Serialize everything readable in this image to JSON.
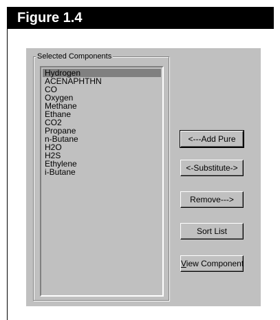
{
  "figure": {
    "label": "Figure 1.4"
  },
  "components": {
    "group_label": "Selected Components",
    "items": [
      {
        "label": "Hydrogen",
        "selected": true
      },
      {
        "label": "ACENAPHTHN"
      },
      {
        "label": "CO"
      },
      {
        "label": "Oxygen"
      },
      {
        "label": "Methane"
      },
      {
        "label": "Ethane"
      },
      {
        "label": "CO2"
      },
      {
        "label": "Propane"
      },
      {
        "label": "n-Butane"
      },
      {
        "label": "H2O"
      },
      {
        "label": "H2S"
      },
      {
        "label": "Ethylene"
      },
      {
        "label": "i-Butane"
      }
    ]
  },
  "buttons": {
    "add_pure": "<---Add Pure",
    "substitute": "<-Substitute->",
    "remove": "Remove--->",
    "sort_list": "Sort List",
    "view_component_accel": "V",
    "view_component_rest": "iew Component"
  },
  "colors": {
    "dialog_bg": "#c0c0c0",
    "selection_bg": "#808080",
    "header_bg": "#000000",
    "header_text": "#ffffff"
  }
}
